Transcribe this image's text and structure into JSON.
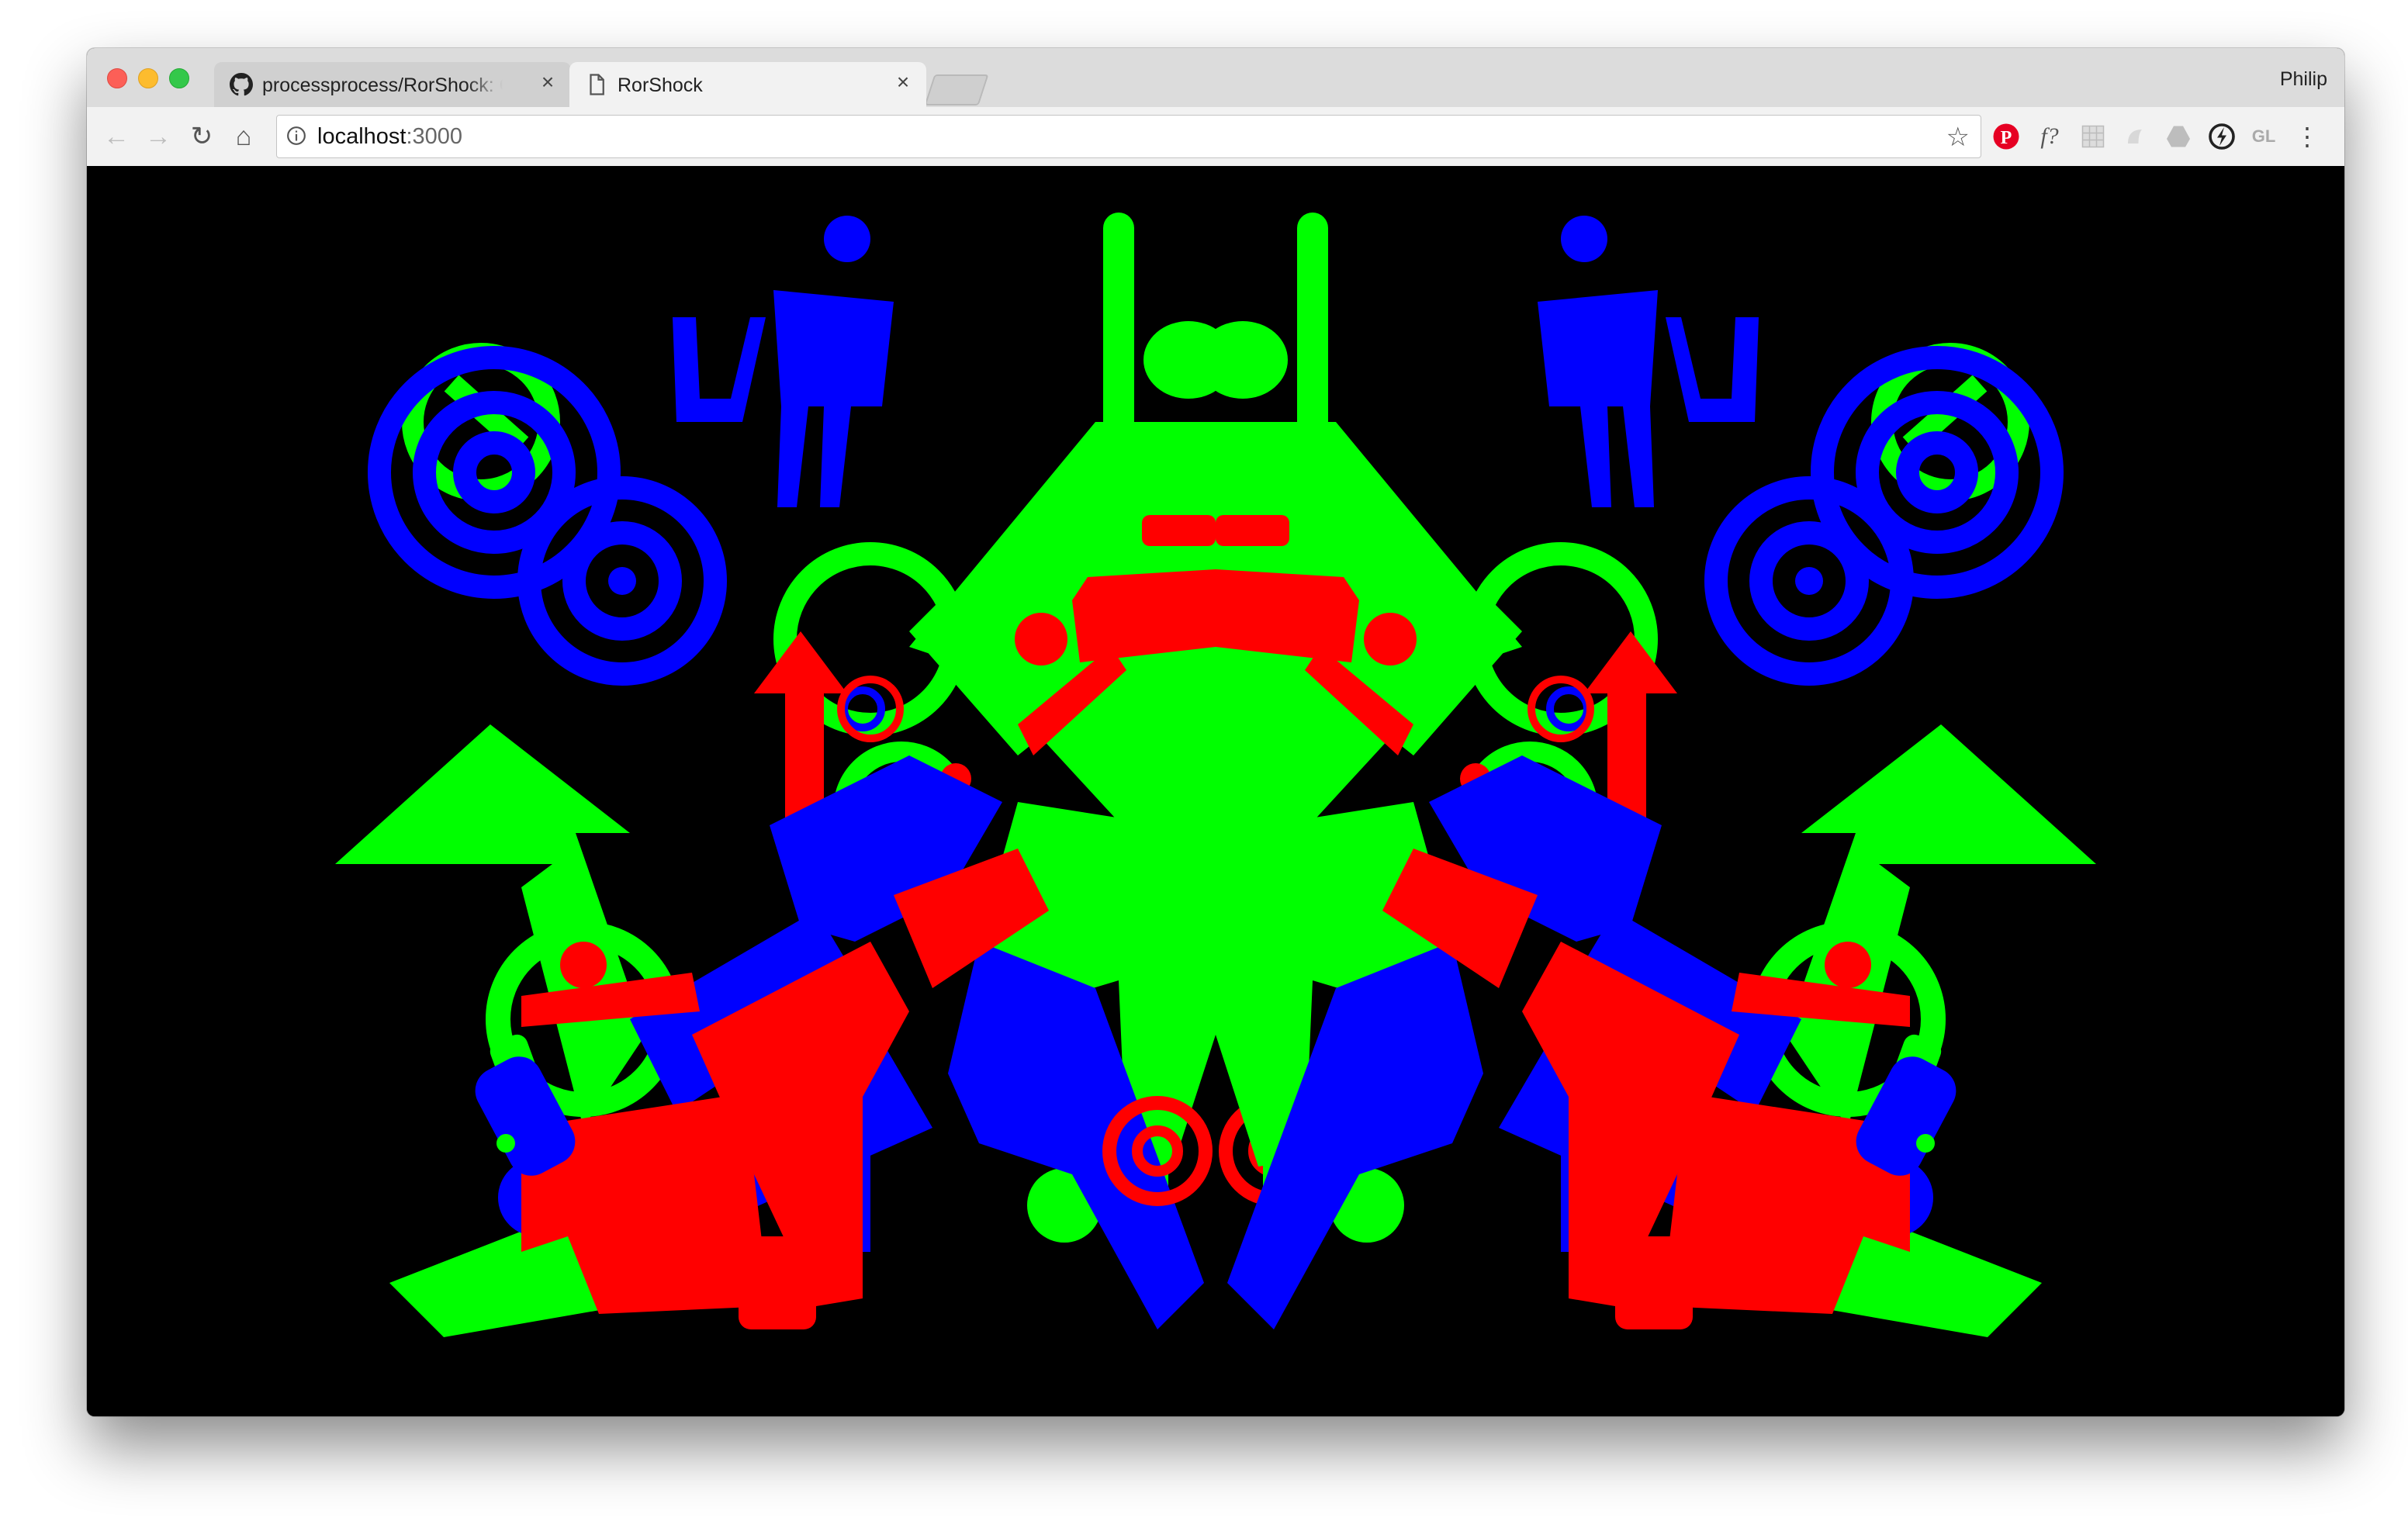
{
  "browser": {
    "profile_name": "Philip",
    "tabs": [
      {
        "label": "processprocess/RorShock: Ge",
        "favicon": "github-icon",
        "active": false
      },
      {
        "label": "RorShock",
        "favicon": "page-icon",
        "active": true
      }
    ],
    "url_host": "localhost",
    "url_port": ":3000",
    "extensions": [
      "pinterest-icon",
      "font-icon",
      "grid-icon",
      "ext-icon",
      "drive-icon",
      "speed-icon",
      "gl-icon",
      "menu-icon"
    ],
    "ext_font_label": "f?",
    "ext_gl_label": "GL"
  },
  "page": {
    "title": "RorShock",
    "background": "#000000",
    "colors": {
      "red": "#ff0000",
      "green": "#00ff00",
      "blue": "#0000ff"
    },
    "symmetry": "mirrored-vertical-axis"
  }
}
